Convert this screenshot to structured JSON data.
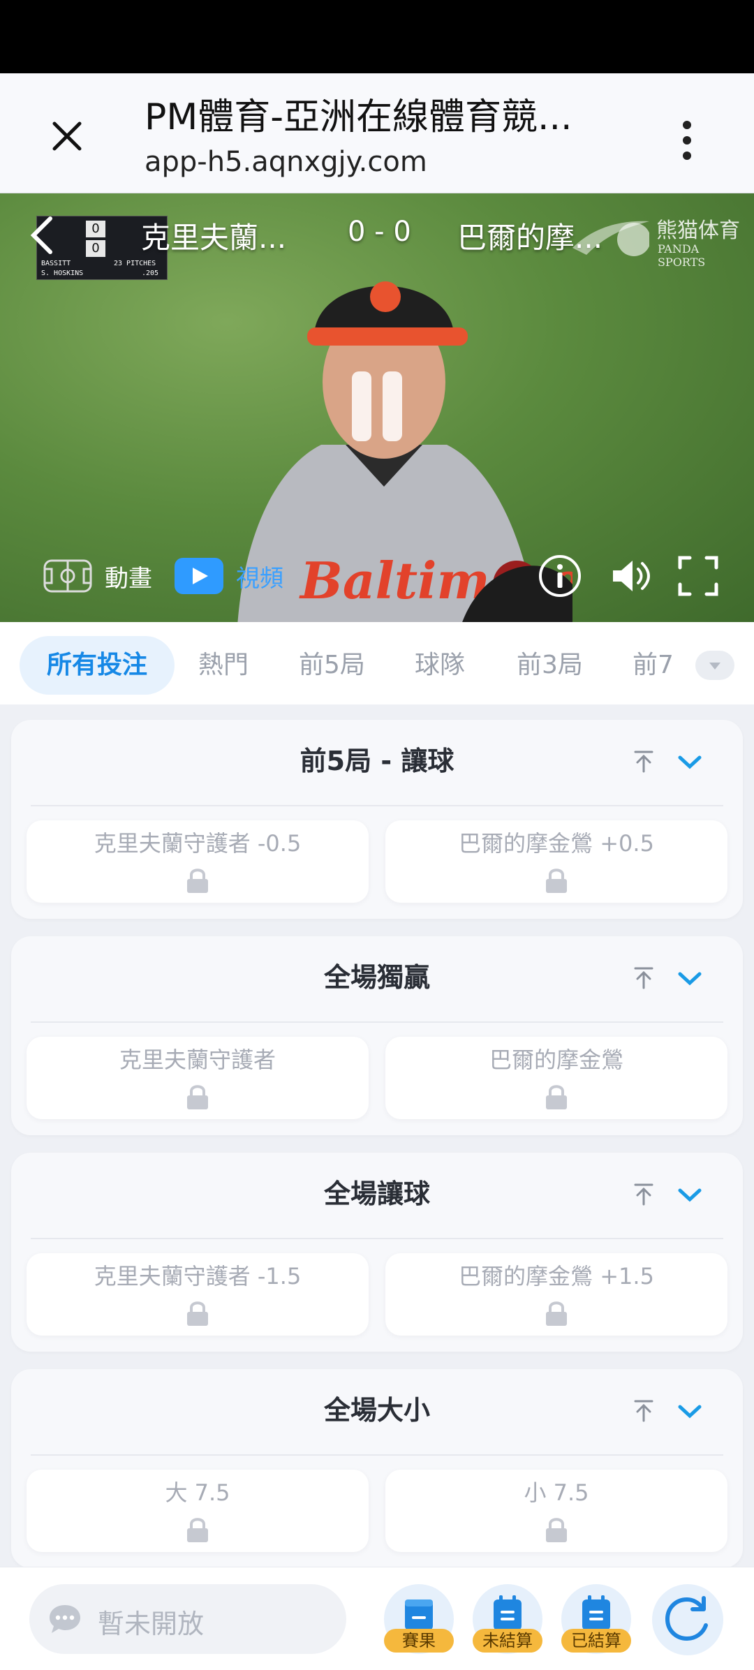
{
  "browser": {
    "title": "PM體育-亞洲在線體育競...",
    "url": "app-h5.aqnxgjy.com"
  },
  "video": {
    "home_team": "克里夫蘭...",
    "score": "0 - 0",
    "away_team": "巴爾的摩...",
    "watermark_cn": "熊猫体育",
    "watermark_en": "PANDA SPORTS",
    "scorebug": {
      "pitcher": "BASSITT",
      "pitches": "23 PITCHES",
      "batter": "S. HOSKINS",
      "avg": ".205",
      "home_runs": "0",
      "away_runs": "0"
    },
    "animation_label": "動畫",
    "video_label": "視頻"
  },
  "tabs": [
    {
      "label": "所有投注",
      "active": true
    },
    {
      "label": "熱門",
      "active": false
    },
    {
      "label": "前5局",
      "active": false
    },
    {
      "label": "球隊",
      "active": false
    },
    {
      "label": "前3局",
      "active": false
    },
    {
      "label": "前7",
      "active": false
    }
  ],
  "markets": [
    {
      "title": "前5局 - 讓球",
      "left": "克里夫蘭守護者 -0.5",
      "right": "巴爾的摩金鶯 +0.5"
    },
    {
      "title": "全場獨贏",
      "left": "克里夫蘭守護者",
      "right": "巴爾的摩金鶯"
    },
    {
      "title": "全場讓球",
      "left": "克里夫蘭守護者 -1.5",
      "right": "巴爾的摩金鶯 +1.5"
    },
    {
      "title": "全場大小",
      "left": "大 7.5",
      "right": "小 7.5"
    }
  ],
  "bottom": {
    "chat_placeholder": "暫未開放",
    "results_label": "賽果",
    "unsettled_label": "未結算",
    "settled_label": "已結算"
  },
  "colors": {
    "accent": "#1688e6",
    "badge": "#f5b83d",
    "locked_text": "#a7abb5"
  }
}
